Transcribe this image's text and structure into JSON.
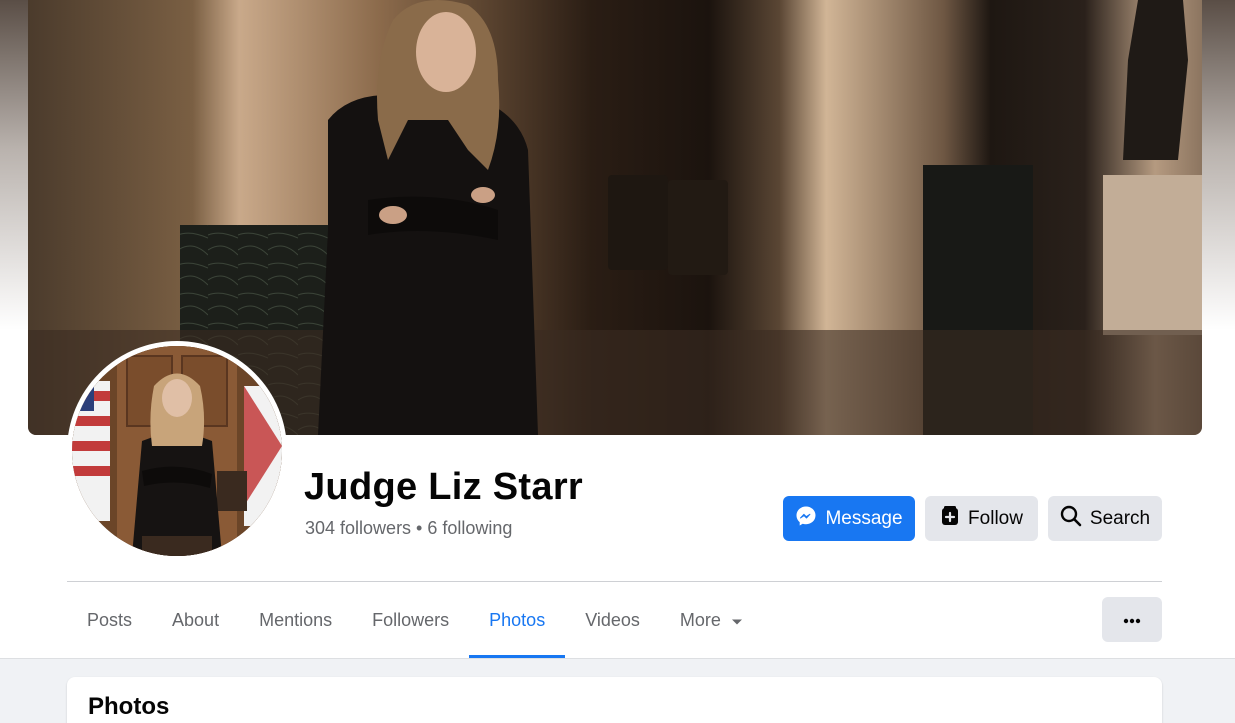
{
  "profile": {
    "name": "Judge Liz Starr",
    "stats": "304 followers • 6 following"
  },
  "actions": {
    "message_label": "Message",
    "follow_label": "Follow",
    "search_label": "Search"
  },
  "tabs": [
    {
      "label": "Posts"
    },
    {
      "label": "About"
    },
    {
      "label": "Mentions"
    },
    {
      "label": "Followers"
    },
    {
      "label": "Photos",
      "active": true
    },
    {
      "label": "Videos"
    },
    {
      "label": "More"
    }
  ],
  "section": {
    "title": "Photos"
  },
  "colors": {
    "accent": "#1877f2",
    "secondary_button": "#e4e6eb",
    "muted_text": "#65676b",
    "feed_background": "#f0f2f5"
  },
  "icons": {
    "message": "messenger-icon",
    "follow": "follow-icon",
    "search": "search-icon",
    "more": "caret-down-icon",
    "options": "ellipsis-icon"
  }
}
